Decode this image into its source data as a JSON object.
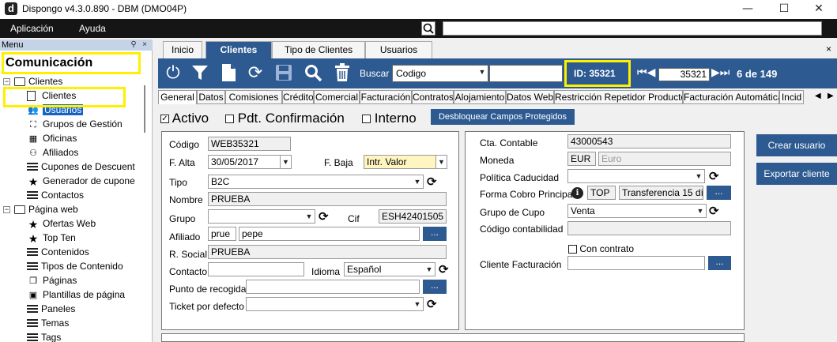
{
  "window": {
    "title": "Dispongo v4.3.0.890 - DBM (DMO04P)",
    "logo": "d",
    "minimize": "—",
    "maximize": "☐",
    "close": "✕"
  },
  "menubar": {
    "items": [
      "Aplicación",
      "Ayuda"
    ]
  },
  "left_panel": {
    "header": "Menu",
    "section_title": "Comunicación",
    "tree": [
      {
        "label": "Clientes",
        "level": 0,
        "icon": "folder-icon",
        "expander": "−"
      },
      {
        "label": "Clientes",
        "level": 1,
        "icon": "document-icon"
      },
      {
        "label": "Usuarios",
        "level": 1,
        "icon": "users-icon",
        "selected": true
      },
      {
        "label": "Grupos de Gestión",
        "level": 1,
        "icon": "group-icon"
      },
      {
        "label": "Oficinas",
        "level": 1,
        "icon": "building-icon"
      },
      {
        "label": "Afiliados",
        "level": 1,
        "icon": "network-icon"
      },
      {
        "label": "Cupones de Descuent",
        "level": 1,
        "icon": "list-icon"
      },
      {
        "label": "Generador de cupone",
        "level": 1,
        "icon": "star-icon"
      },
      {
        "label": "Contactos",
        "level": 1,
        "icon": "list-icon"
      },
      {
        "label": "Página web",
        "level": 0,
        "icon": "folder-icon",
        "expander": "−"
      },
      {
        "label": "Ofertas Web",
        "level": 1,
        "icon": "star-icon"
      },
      {
        "label": "Top Ten",
        "level": 1,
        "icon": "star-icon"
      },
      {
        "label": "Contenidos",
        "level": 1,
        "icon": "list-icon"
      },
      {
        "label": "Tipos de Contenido",
        "level": 1,
        "icon": "list-icon"
      },
      {
        "label": "Páginas",
        "level": 1,
        "icon": "pages-icon"
      },
      {
        "label": "Plantillas de página",
        "level": 1,
        "icon": "template-icon"
      },
      {
        "label": "Paneles",
        "level": 1,
        "icon": "list-icon"
      },
      {
        "label": "Temas",
        "level": 1,
        "icon": "list-icon"
      },
      {
        "label": "Tags",
        "level": 1,
        "icon": "list-icon"
      }
    ]
  },
  "tabs": [
    {
      "label": "Inicio",
      "active": false
    },
    {
      "label": "Clientes",
      "active": true
    },
    {
      "label": "Tipo de Clientes",
      "active": false
    },
    {
      "label": "Usuarios",
      "active": false
    }
  ],
  "tabs_close": "×",
  "toolbar": {
    "buscar_label": "Buscar",
    "buscar_select": "Codigo",
    "buscar_value": "",
    "id_label": "ID: 35321",
    "nav_value": "35321",
    "nav_count": "6 de 149"
  },
  "subtabs": [
    "General",
    "Datos",
    "Comisiones",
    "Crédito",
    "Comercial",
    "Facturación",
    "Contratos",
    "Alojamiento",
    "Datos Web",
    "Restricción Repetidor Producto",
    "Facturación Automática",
    "Incid"
  ],
  "flags": {
    "activo": {
      "label": "Activo",
      "checked": true
    },
    "pdt": {
      "label": "Pdt. Confirmación",
      "checked": false
    },
    "interno": {
      "label": "Interno",
      "checked": false
    },
    "unlock_button": "Desbloquear Campos Protegidos"
  },
  "left_form": {
    "codigo_label": "Código",
    "codigo_value": "WEB35321",
    "falta_label": "F. Alta",
    "falta_value": "30/05/2017",
    "fbaja_label": "F. Baja",
    "fbaja_value": "Intr. Valor",
    "tipo_label": "Tipo",
    "tipo_value": "B2C",
    "nombre_label": "Nombre",
    "nombre_value": "PRUEBA",
    "grupo_label": "Grupo",
    "grupo_value": "",
    "cif_label": "Cif",
    "cif_value": "ESH42401505",
    "afiliado_label": "Afiliado",
    "afiliado_code": "prue",
    "afiliado_value": "pepe",
    "rsocial_label": "R. Social",
    "rsocial_value": "PRUEBA",
    "contacto_label": "Contacto",
    "contacto_value": "",
    "idioma_label": "Idioma",
    "idioma_value": "Español",
    "recogida_label": "Punto de recogida",
    "recogida_value": "",
    "ticket_label": "Ticket por defecto",
    "ticket_value": "",
    "dots": "..."
  },
  "right_form": {
    "cta_label": "Cta. Contable",
    "cta_value": "43000543",
    "moneda_label": "Moneda",
    "moneda_code": "EUR",
    "moneda_value": "Euro",
    "politica_label": "Política Caducidad",
    "politica_value": "",
    "forma_label": "Forma Cobro Principal",
    "forma_code": "TOP",
    "forma_value": "Transferencia 15 dí",
    "cupo_label": "Grupo de Cupo",
    "cupo_value": "Venta",
    "codcont_label": "Código contabilidad",
    "codcont_value": "",
    "contrato_label": "Con contrato",
    "contrato_checked": false,
    "clientefact_label": "Cliente Facturación",
    "clientefact_value": "",
    "dots": "..."
  },
  "side_buttons": {
    "crear": "Crear usuario",
    "exportar": "Exportar cliente"
  }
}
